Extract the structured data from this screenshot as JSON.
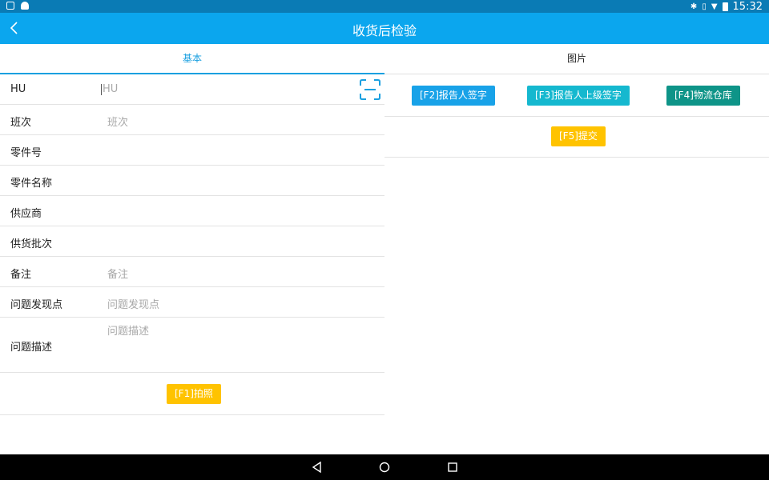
{
  "status_bar": {
    "left_icons": [
      "image-icon",
      "android-icon"
    ],
    "right_icons": [
      "bluetooth-icon",
      "vibrate-icon",
      "wifi-icon",
      "battery-icon"
    ],
    "time": "15:32"
  },
  "app_bar": {
    "title": "收货后检验",
    "back_icon": "chevron-left-icon"
  },
  "tabs": [
    {
      "label": "基本",
      "active": true
    },
    {
      "label": "图片",
      "active": false
    }
  ],
  "form": {
    "fields": [
      {
        "label": "HU",
        "placeholder": "HU"
      },
      {
        "label": "班次",
        "placeholder": "班次"
      },
      {
        "label": "零件号",
        "placeholder": ""
      },
      {
        "label": "零件名称",
        "placeholder": ""
      },
      {
        "label": "供应商",
        "placeholder": ""
      },
      {
        "label": "供货批次",
        "placeholder": ""
      },
      {
        "label": "备注",
        "placeholder": "备注"
      },
      {
        "label": "问题发现点",
        "placeholder": "问题发现点"
      },
      {
        "label": "问题描述",
        "placeholder": "问题描述"
      }
    ],
    "photo_button": "[F1]拍照"
  },
  "image_panel": {
    "buttons": {
      "f2": "[F2]报告人签字",
      "f3": "[F3]报告人上级签字",
      "f4": "[F4]物流仓库",
      "f5": "[F5]提交"
    }
  },
  "colors": {
    "status_bar": "#0a7bb5",
    "app_bar": "#0ba6ee",
    "tab_active": "#1aa0e0",
    "yellow": "#ffc300",
    "blue": "#18a2e8",
    "cyan": "#15b8cf",
    "teal": "#0e9488"
  }
}
